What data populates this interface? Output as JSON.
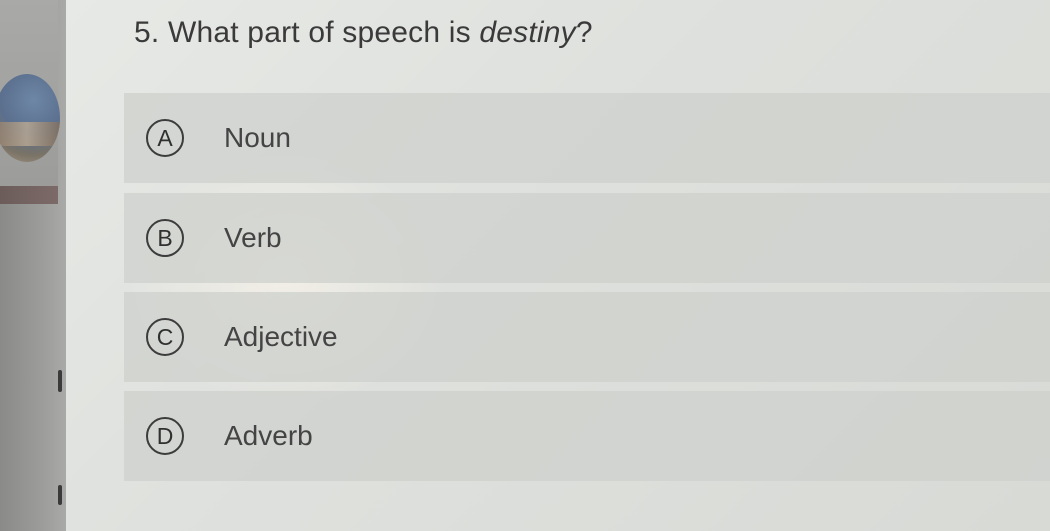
{
  "question": {
    "number_prefix": "5. What part of speech is ",
    "emphasis": "destiny",
    "suffix": "?"
  },
  "options": [
    {
      "letter": "A",
      "label": "Noun"
    },
    {
      "letter": "B",
      "label": "Verb"
    },
    {
      "letter": "C",
      "label": "Adjective"
    },
    {
      "letter": "D",
      "label": "Adverb"
    }
  ],
  "colors": {
    "card_background": "#e1e3e0",
    "option_background": "#cdd0cc",
    "text": "#3a3a3a"
  }
}
